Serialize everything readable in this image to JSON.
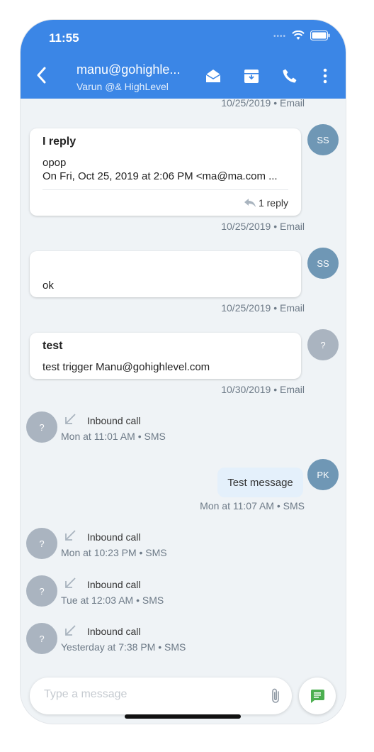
{
  "status_bar": {
    "time": "11:55"
  },
  "header": {
    "title": "manu@gohighle...",
    "subtitle": "Varun @& HighLevel",
    "icons": [
      "back-icon",
      "envelope-open-icon",
      "archive-icon",
      "phone-icon",
      "more-vertical-icon"
    ]
  },
  "messages": [
    {
      "meta": "10/25/2019 • Email"
    },
    {
      "title": "I reply",
      "line1": "opop",
      "line2": "On Fri, Oct 25, 2019 at 2:06 PM <ma@ma.com ...",
      "replies": "1 reply",
      "meta": "10/25/2019 • Email",
      "avatar": "SS"
    },
    {
      "text": "ok",
      "meta": "10/25/2019 • Email",
      "avatar": "SS"
    },
    {
      "title": "test",
      "text": "test trigger Manu@gohighlevel.com",
      "meta": "10/30/2019 • Email",
      "avatar": "?"
    },
    {
      "label": "Inbound call",
      "meta": "Mon at 11:01 AM • SMS",
      "avatar": "?"
    },
    {
      "text": "Test message",
      "meta": "Mon at 11:07 AM • SMS",
      "avatar": "PK"
    },
    {
      "label": "Inbound call",
      "meta": "Mon at 10:23 PM • SMS",
      "avatar": "?"
    },
    {
      "label": "Inbound call",
      "meta": "Tue at 12:03 AM • SMS",
      "avatar": "?"
    },
    {
      "label": "Inbound call",
      "meta": "Yesterday at 7:38 PM • SMS",
      "avatar": "?"
    }
  ],
  "composer": {
    "placeholder": "Type a message"
  },
  "colors": {
    "header": "#3b86e6",
    "send_icon": "#4caf50",
    "avatar_blue": "#6f97b5",
    "avatar_gray": "#aab4c0"
  }
}
